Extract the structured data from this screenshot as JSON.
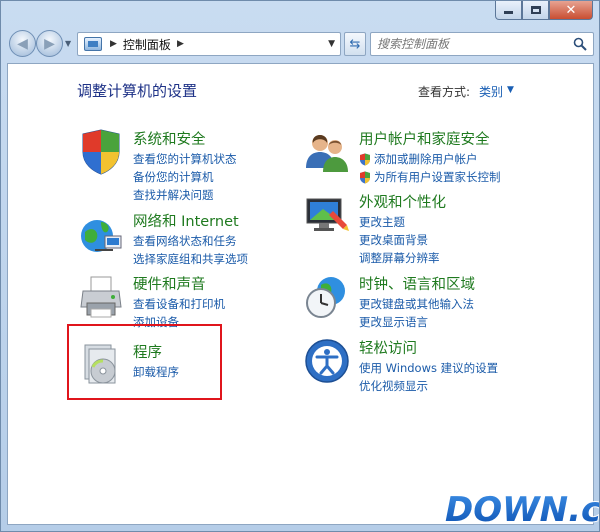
{
  "address": {
    "path": "控制面板",
    "search_placeholder": "搜索控制面板"
  },
  "header": {
    "title": "调整计算机的设置",
    "view_by_label": "查看方式:",
    "view_by_value": "类别"
  },
  "categories": [
    {
      "id": "system",
      "title": "系统和安全",
      "icon": "shield-icon",
      "links": [
        "查看您的计算机状态",
        "备份您的计算机",
        "查找并解决问题"
      ]
    },
    {
      "id": "network",
      "title": "网络和 Internet",
      "icon": "globe-network-icon",
      "links": [
        "查看网络状态和任务",
        "选择家庭组和共享选项"
      ]
    },
    {
      "id": "hardware",
      "title": "硬件和声音",
      "icon": "printer-icon",
      "links": [
        "查看设备和打印机",
        "添加设备"
      ]
    },
    {
      "id": "programs",
      "title": "程序",
      "icon": "programs-icon",
      "links": [
        "卸载程序"
      ]
    },
    {
      "id": "users",
      "title": "用户帐户和家庭安全",
      "icon": "users-icon",
      "links": [
        "添加或删除用户帐户",
        "为所有用户设置家长控制"
      ]
    },
    {
      "id": "appearance",
      "title": "外观和个性化",
      "icon": "monitor-icon",
      "links": [
        "更改主题",
        "更改桌面背景",
        "调整屏幕分辨率"
      ]
    },
    {
      "id": "clock",
      "title": "时钟、语言和区域",
      "icon": "clock-globe-icon",
      "links": [
        "更改键盘或其他输入法",
        "更改显示语言"
      ]
    },
    {
      "id": "ease",
      "title": "轻松访问",
      "icon": "ease-of-access-icon",
      "links": [
        "使用 Windows 建议的设置",
        "优化视频显示"
      ]
    }
  ],
  "watermark": {
    "text": "DOWN.cc"
  },
  "colors": {
    "category_title": "#1f7a1f",
    "link": "#1b5ba9",
    "page_title": "#1e3287",
    "highlight_box": "#e0151c"
  }
}
